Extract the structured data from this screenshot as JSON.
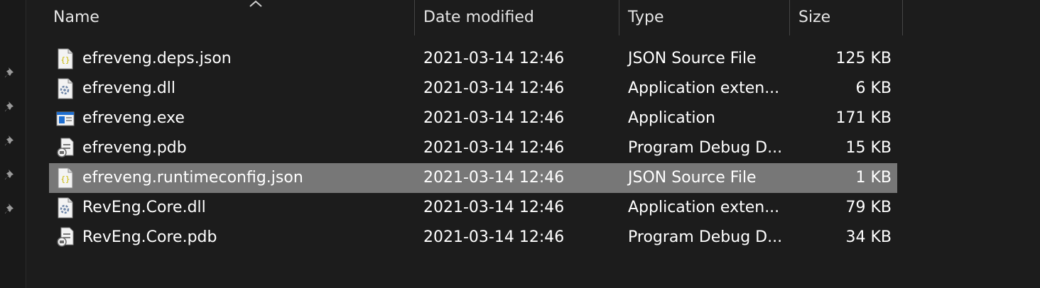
{
  "columns": {
    "name": "Name",
    "date": "Date modified",
    "type": "Type",
    "size": "Size"
  },
  "sort": {
    "column": "name",
    "direction": "ascending",
    "icon": "sort-caret-up-icon"
  },
  "quick_access_pins": 5,
  "files": [
    {
      "name": "efreveng.deps.json",
      "date": "2021-03-14 12:46",
      "type": "JSON Source File",
      "size": "125 KB",
      "icon": "json-file-icon",
      "selected": false
    },
    {
      "name": "efreveng.dll",
      "date": "2021-03-14 12:46",
      "type": "Application exten...",
      "size": "6 KB",
      "icon": "dll-file-icon",
      "selected": false
    },
    {
      "name": "efreveng.exe",
      "date": "2021-03-14 12:46",
      "type": "Application",
      "size": "171 KB",
      "icon": "exe-file-icon",
      "selected": false
    },
    {
      "name": "efreveng.pdb",
      "date": "2021-03-14 12:46",
      "type": "Program Debug D...",
      "size": "15 KB",
      "icon": "pdb-file-icon",
      "selected": false
    },
    {
      "name": "efreveng.runtimeconfig.json",
      "date": "2021-03-14 12:46",
      "type": "JSON Source File",
      "size": "1 KB",
      "icon": "json-file-icon",
      "selected": true
    },
    {
      "name": "RevEng.Core.dll",
      "date": "2021-03-14 12:46",
      "type": "Application exten...",
      "size": "79 KB",
      "icon": "dll-file-icon",
      "selected": false
    },
    {
      "name": "RevEng.Core.pdb",
      "date": "2021-03-14 12:46",
      "type": "Program Debug D...",
      "size": "34 KB",
      "icon": "pdb-file-icon",
      "selected": false
    }
  ],
  "colors": {
    "background": "#1c1c1c",
    "selection": "#777777",
    "text": "#ffffff",
    "json_brace": "#c9b800",
    "exe_blue": "#1f6fd1"
  }
}
